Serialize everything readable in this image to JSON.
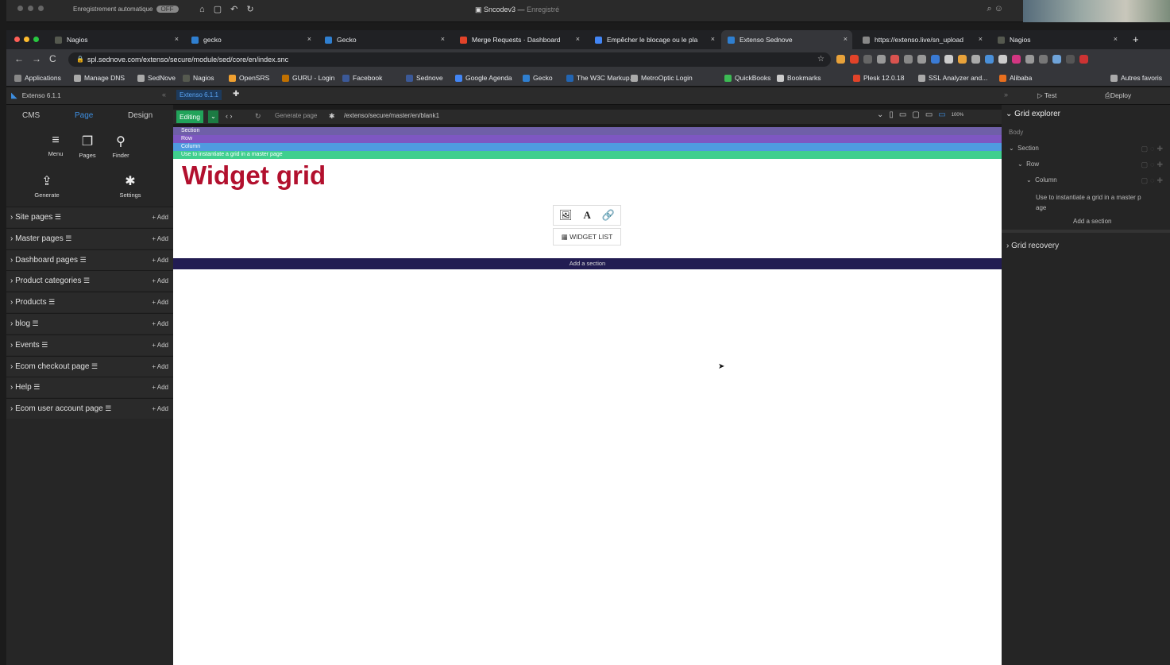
{
  "word": {
    "autosave_label": "Enregistrement automatique",
    "autosave_state": "OFF",
    "doc_title": "Sncodev3",
    "doc_status": "Enregistré"
  },
  "browser": {
    "tabs": [
      {
        "label": "Nagios",
        "color": "#55594f"
      },
      {
        "label": "gecko",
        "color": "#2f7fd0"
      },
      {
        "label": "Gecko",
        "color": "#2f7fd0"
      },
      {
        "label": "Merge Requests · Dashboard",
        "color": "#e24329"
      },
      {
        "label": "Empêcher le blocage ou le pla",
        "color": "#4285f4"
      },
      {
        "label": "Extenso Sednove",
        "color": "#2f7fd0"
      },
      {
        "label": "https://extenso.live/sn_upload",
        "color": "#888888"
      },
      {
        "label": "Nagios",
        "color": "#55594f"
      }
    ],
    "url": "spl.sednove.com/extenso/secure/module/sed/core/en/index.snc",
    "bookmarks": [
      "Applications",
      "Manage DNS",
      "SedNove",
      "Nagios",
      "OpenSRS",
      "GURU - Login",
      "Facebook",
      "Sednove",
      "Google Agenda",
      "Gecko",
      "The W3C Markup...",
      "MetroOptic Login",
      "QuickBooks",
      "Bookmarks",
      "Plesk 12.0.18",
      "SSL Analyzer and...",
      "Alibaba",
      "Autres favoris"
    ]
  },
  "app": {
    "version_left": "Extenso 6.1.1",
    "version_tab": "Extenso 6.1.1",
    "test_label": "Test",
    "deploy_label": "Deploy"
  },
  "sidebar": {
    "tabs": [
      "CMS",
      "Page",
      "Design"
    ],
    "tools": [
      {
        "label": "Menu",
        "icon": "menu-edit-icon"
      },
      {
        "label": "Pages",
        "icon": "pages-icon"
      },
      {
        "label": "Finder",
        "icon": "finder-icon"
      }
    ],
    "big_tools": [
      {
        "label": "Generate",
        "icon": "generate-icon"
      },
      {
        "label": "Settings",
        "icon": "gear-icon"
      }
    ],
    "add_label": "+ Add",
    "sections": [
      "Site pages",
      "Master pages",
      "Dashboard pages",
      "Product categories",
      "Products",
      "blog",
      "Events",
      "Ecom checkout page",
      "Help",
      "Ecom user account page"
    ]
  },
  "editor": {
    "mode": "Editing",
    "generate_label": "Generate page",
    "path": "/extenso/secure/master/en/blank1",
    "zoom": "100%",
    "highlights": [
      {
        "label": "Section",
        "color": "#6f5fa8"
      },
      {
        "label": "Row",
        "color": "#7e57c2"
      },
      {
        "label": "Column",
        "color": "#4f9be0"
      },
      {
        "label": "Use to instantiate a grid in a master page",
        "color": "#3fcf8e"
      }
    ],
    "title": "Widget grid",
    "widget_list": "WIDGET LIST",
    "add_section": "Add a section"
  },
  "grid_explorer": {
    "title": "Grid explorer",
    "body": "Body",
    "section": "Section",
    "row": "Row",
    "column": "Column",
    "item_line1": "Use to instantiate a grid in a master p",
    "item_line2": "age",
    "add_section": "Add a section",
    "recovery": "Grid recovery"
  }
}
